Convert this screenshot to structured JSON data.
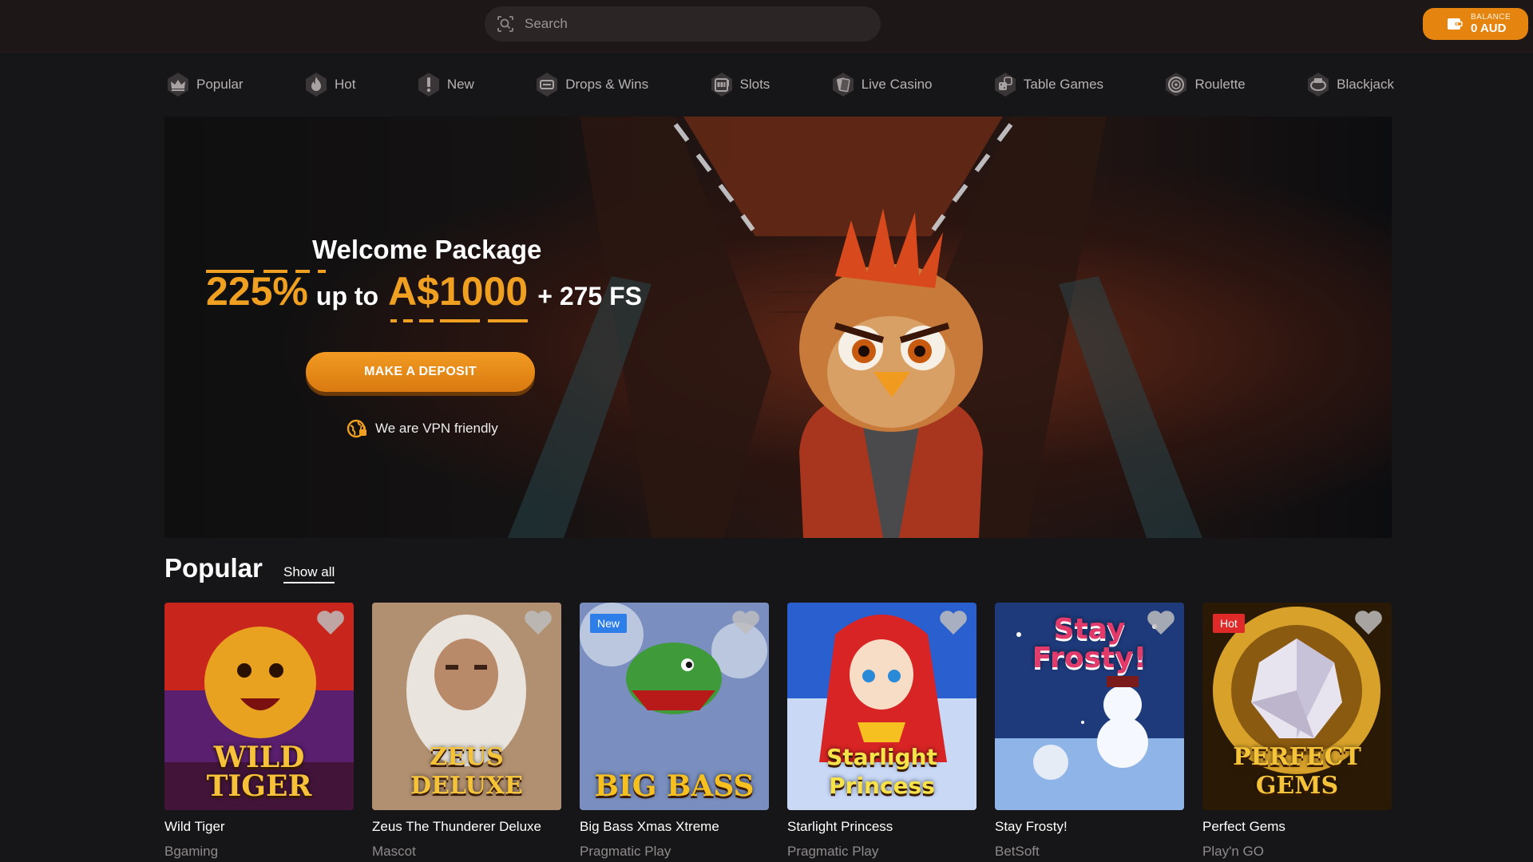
{
  "header": {
    "search_placeholder": "Search",
    "balance_label": "BALANCE",
    "balance_value": "0 AUD"
  },
  "nav": [
    {
      "label": "Popular",
      "icon": "crown-icon"
    },
    {
      "label": "Hot",
      "icon": "flame-icon"
    },
    {
      "label": "New",
      "icon": "exclamation-icon"
    },
    {
      "label": "Drops & Wins",
      "icon": "drops-wins-icon"
    },
    {
      "label": "Slots",
      "icon": "slot-machine-icon"
    },
    {
      "label": "Live Casino",
      "icon": "playing-cards-icon"
    },
    {
      "label": "Table Games",
      "icon": "dice-icon"
    },
    {
      "label": "Roulette",
      "icon": "roulette-icon"
    },
    {
      "label": "Blackjack",
      "icon": "blackjack-icon"
    }
  ],
  "hero": {
    "title": "Welcome Package",
    "percent": "225%",
    "up_to": "up to",
    "amount": "A$1000",
    "free_spins": "+ 275 FS",
    "cta": "MAKE A DEPOSIT",
    "vpn_text": "We are VPN friendly"
  },
  "section": {
    "title": "Popular",
    "show_all": "Show all"
  },
  "games": [
    {
      "name": "Wild Tiger",
      "provider": "Bgaming",
      "tag": "",
      "logo": "WILD TIGER",
      "colors": [
        "#c8251c",
        "#5a1f6e"
      ]
    },
    {
      "name": "Zeus The Thunderer Deluxe",
      "provider": "Mascot",
      "tag": "",
      "logo": "ZEUS DELUXE",
      "colors": [
        "#c7a27a",
        "#6b5244"
      ]
    },
    {
      "name": "Big Bass Xmas Xtreme",
      "provider": "Pragmatic Play",
      "tag": "New",
      "logo": "BIG BASS",
      "colors": [
        "#7a8fbf",
        "#4b2a6a"
      ]
    },
    {
      "name": "Starlight Princess",
      "provider": "Pragmatic Play",
      "tag": "",
      "logo": "Starlight Princess",
      "colors": [
        "#2a5fd0",
        "#c8d8f5"
      ]
    },
    {
      "name": "Stay Frosty!",
      "provider": "BetSoft",
      "tag": "",
      "logo": "Stay Frosty!",
      "colors": [
        "#1e3a7a",
        "#8fb4e8"
      ]
    },
    {
      "name": "Perfect Gems",
      "provider": "Play'n GO",
      "tag": "Hot",
      "logo": "PERFECT GEMS",
      "colors": [
        "#2a1a05",
        "#d8a22a"
      ]
    }
  ]
}
